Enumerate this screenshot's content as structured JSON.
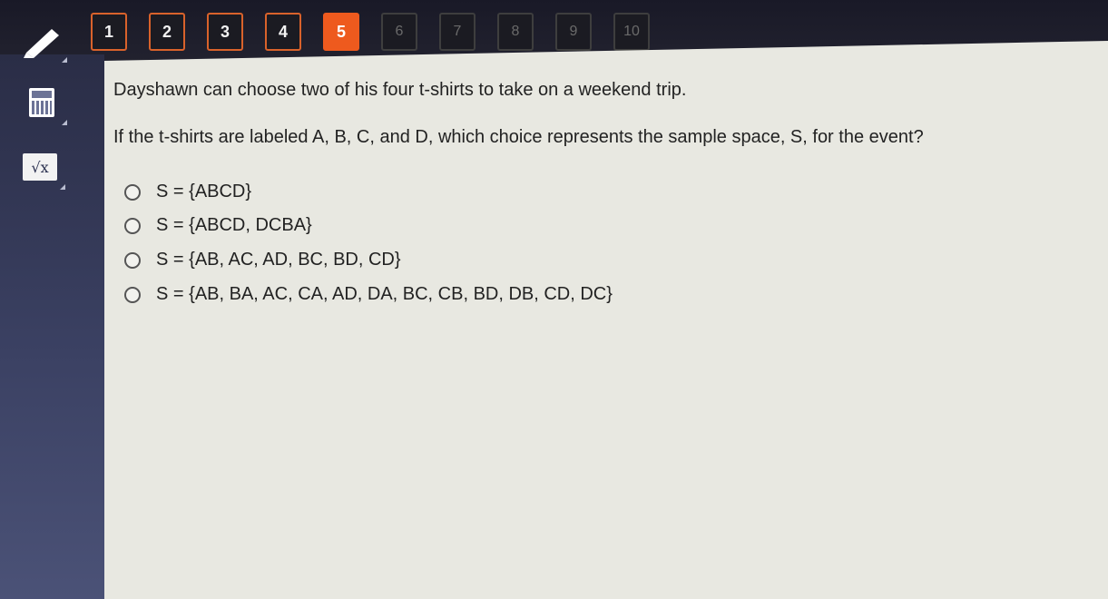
{
  "tools": {
    "pencil": {
      "icon": "pencil-icon"
    },
    "calculator": {
      "icon": "calculator-icon"
    },
    "reference": {
      "icon": "square-root-icon",
      "symbol": "√x"
    }
  },
  "question_nav": [
    {
      "label": "1",
      "state": "done"
    },
    {
      "label": "2",
      "state": "done"
    },
    {
      "label": "3",
      "state": "done"
    },
    {
      "label": "4",
      "state": "done"
    },
    {
      "label": "5",
      "state": "current"
    },
    {
      "label": "6",
      "state": "todo"
    },
    {
      "label": "7",
      "state": "todo"
    },
    {
      "label": "8",
      "state": "todo"
    },
    {
      "label": "9",
      "state": "todo"
    },
    {
      "label": "10",
      "state": "todo"
    }
  ],
  "question": {
    "stem_line1": "Dayshawn can choose two of his four t-shirts to take on a weekend trip.",
    "stem_line2": "If the t-shirts are labeled A, B, C, and D, which choice represents the sample space, S, for the event?",
    "choices": [
      {
        "text": "S = {ABCD}"
      },
      {
        "text": "S = {ABCD, DCBA}"
      },
      {
        "text": "S = {AB, AC, AD, BC, BD, CD}"
      },
      {
        "text": "S = {AB, BA, AC, CA, AD, DA, BC, CB, BD, DB, CD, DC}"
      }
    ]
  },
  "colors": {
    "current_question": "#ee5a1e",
    "answered_border": "#d9622b",
    "panel_bg": "#e8e8e1",
    "rail_bg": "#3b4163"
  }
}
